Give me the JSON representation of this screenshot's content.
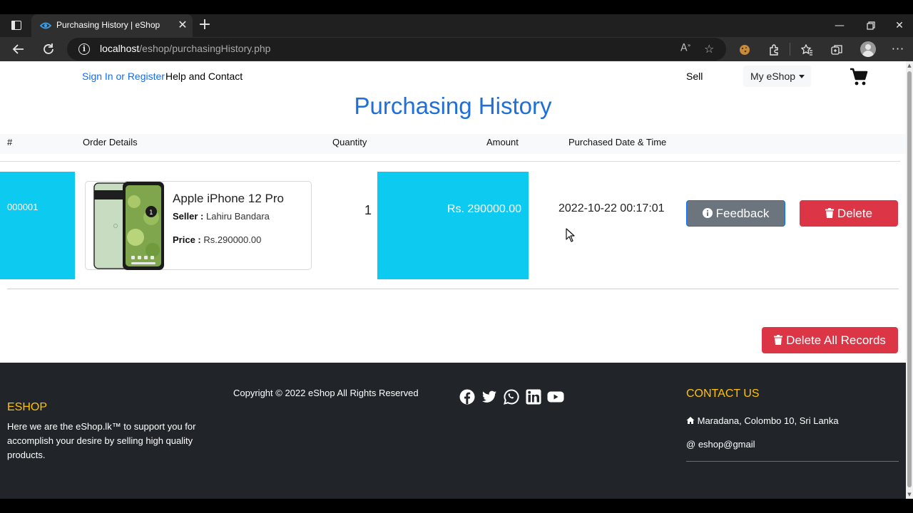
{
  "browser": {
    "tab_title": "Purchasing History | eShop",
    "url_host": "localhost",
    "url_path": "/eshop/purchasingHistory.php"
  },
  "header": {
    "signin_label": "Sign In or Register",
    "help_label": "Help and Contact",
    "sell_label": "Sell",
    "myeshop_label": "My eShop"
  },
  "page_title": "Purchasing History",
  "table": {
    "headers": [
      "#",
      "Order Details",
      "Quantity",
      "Amount",
      "Purchased Date & Time"
    ],
    "rows": [
      {
        "order_id": "000001",
        "product_name": "Apple iPhone 12 Pro",
        "seller_label": "Seller :",
        "seller_name": "Lahiru Bandara",
        "price_label": "Price :",
        "price_value": "Rs.290000.00",
        "quantity": "1",
        "amount": "Rs. 290000.00",
        "purchased_datetime": "2022-10-22 00:17:01",
        "feedback_label": "Feedback",
        "delete_label": "Delete"
      }
    ]
  },
  "delete_all_label": "Delete All Records",
  "footer": {
    "brand": "ESHOP",
    "about": "Here we are the eShop.lk™ to support you for accomplish your desire by selling high quality products.",
    "copyright": "Copyright © 2022 eShop All Rights Reserved",
    "social_icons": [
      "facebook-icon",
      "twitter-icon",
      "whatsapp-icon",
      "linkedin-icon",
      "youtube-icon"
    ],
    "contact_title": "CONTACT US",
    "contact_address": "Maradana, Colombo 10, Sri Lanka",
    "contact_email": "eshop@gmail"
  },
  "colors": {
    "primary": "#0d6efd",
    "title_blue": "#1e6fd9",
    "info_cell": "#0dcaf0",
    "danger": "#dc3545",
    "secondary": "#6c757d",
    "footer_bg": "#212529",
    "footer_accent": "#ffc107"
  }
}
